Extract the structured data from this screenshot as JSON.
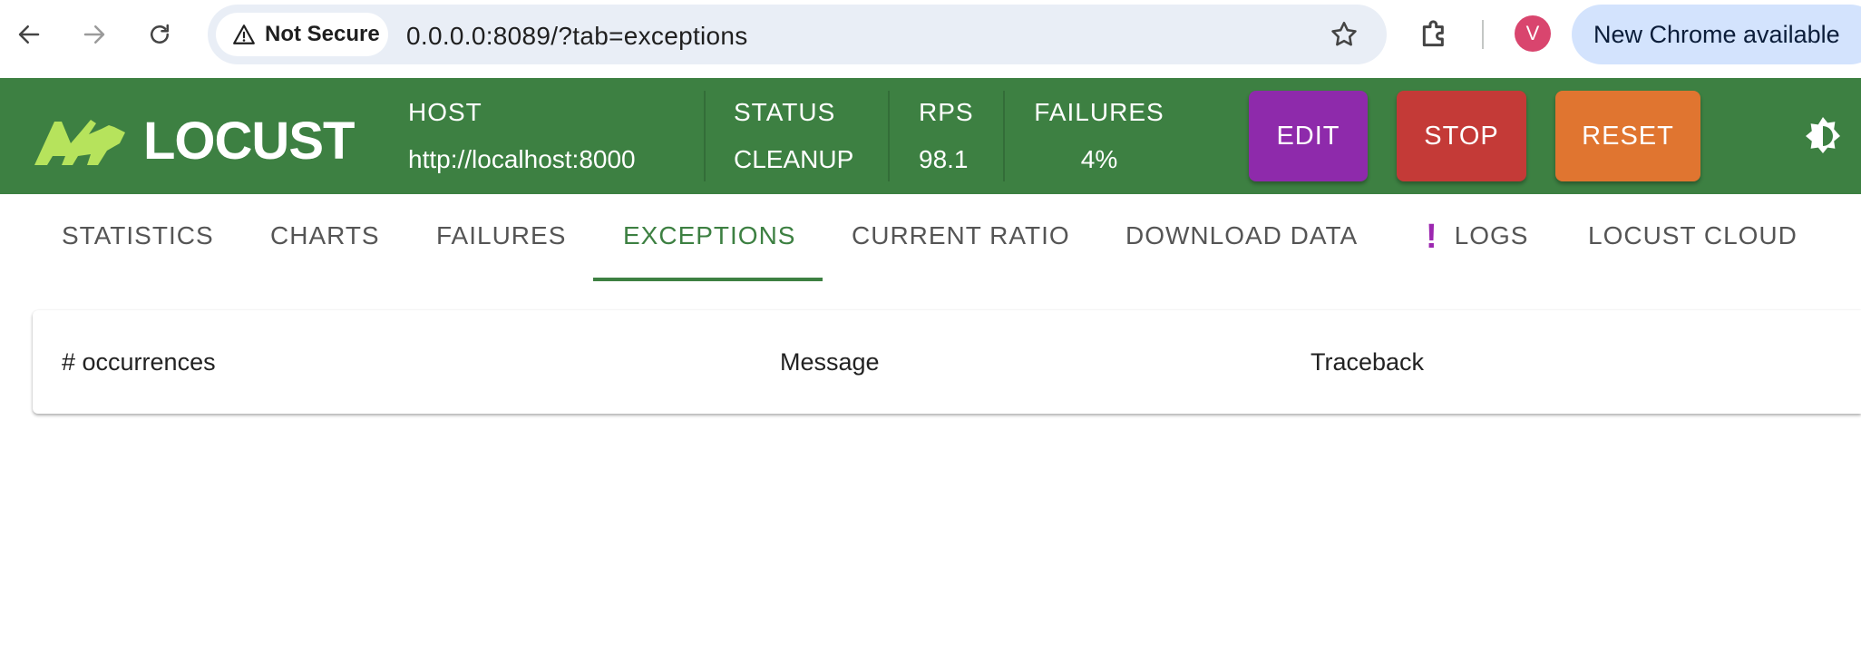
{
  "browser": {
    "security_label": "Not Secure",
    "url": "0.0.0.0:8089/?tab=exceptions",
    "profile_initial": "V",
    "update_label": "New Chrome available"
  },
  "header": {
    "logo_text": "LOCUST",
    "host_label": "HOST",
    "host_value": "http://localhost:8000",
    "status_label": "STATUS",
    "status_value": "CLEANUP",
    "rps_label": "RPS",
    "rps_value": "98.1",
    "failures_label": "FAILURES",
    "failures_value": "4%",
    "edit_label": "EDIT",
    "stop_label": "STOP",
    "reset_label": "RESET",
    "colors": {
      "header_bg": "#3d8042",
      "edit": "#8e2aab",
      "stop": "#c43a37",
      "reset": "#e07530"
    }
  },
  "tabs": [
    {
      "label": "STATISTICS"
    },
    {
      "label": "CHARTS"
    },
    {
      "label": "FAILURES"
    },
    {
      "label": "EXCEPTIONS",
      "active": true
    },
    {
      "label": "CURRENT RATIO"
    },
    {
      "label": "DOWNLOAD DATA"
    },
    {
      "label": "LOGS",
      "icon": "exclamation-icon"
    },
    {
      "label": "LOCUST CLOUD"
    }
  ],
  "exceptions_table": {
    "columns": [
      "# occurrences",
      "Message",
      "Traceback"
    ]
  }
}
